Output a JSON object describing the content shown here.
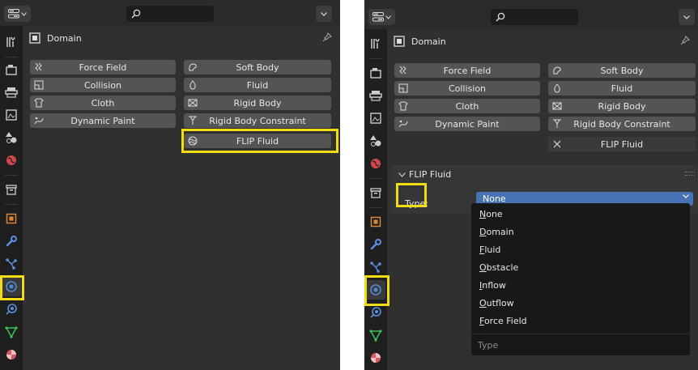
{
  "header": {
    "title": "Domain"
  },
  "physics_buttons": {
    "force_field": "Force Field",
    "collision": "Collision",
    "cloth": "Cloth",
    "dynamic_paint": "Dynamic Paint",
    "soft_body": "Soft Body",
    "fluid": "Fluid",
    "rigid_body": "Rigid Body",
    "rigid_body_constraint": "Rigid Body Constraint",
    "flip_fluid": "FLIP Fluid"
  },
  "flip_panel": {
    "title": "FLIP Fluid",
    "type_label": "Type:",
    "type_value": "None"
  },
  "type_menu": {
    "items": [
      "None",
      "Domain",
      "Fluid",
      "Obstacle",
      "Inflow",
      "Outflow",
      "Force Field"
    ],
    "footer": "Type"
  },
  "colors": {
    "highlight": "#f2dc14",
    "selected": "#4772b3",
    "physics_tab": "#4f8ad8"
  }
}
